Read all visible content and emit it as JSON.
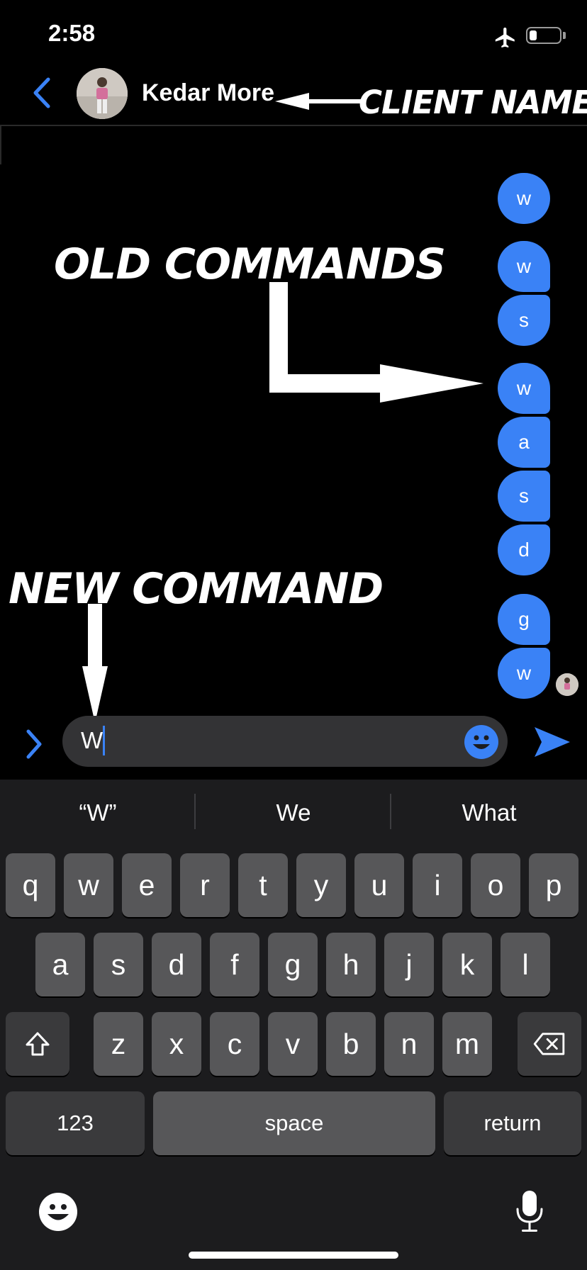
{
  "status_bar": {
    "time": "2:58",
    "airplane_icon": "airplane-icon",
    "battery_level": 0.25
  },
  "header": {
    "contact_name": "Kedar More",
    "back_icon": "chevron-left-icon"
  },
  "annotations": {
    "client_name": "CLIENT NAME",
    "old_commands": "OLD COMMANDS",
    "new_command": "NEW COMMAND"
  },
  "messages": [
    "w",
    "w",
    "s",
    "w",
    "a",
    "s",
    "d",
    "g",
    "w"
  ],
  "compose": {
    "text": "W"
  },
  "keyboard": {
    "suggestions": [
      "“W”",
      "We",
      "What"
    ],
    "row1": [
      "q",
      "w",
      "e",
      "r",
      "t",
      "y",
      "u",
      "i",
      "o",
      "p"
    ],
    "row2": [
      "a",
      "s",
      "d",
      "f",
      "g",
      "h",
      "j",
      "k",
      "l"
    ],
    "row3": [
      "z",
      "x",
      "c",
      "v",
      "b",
      "n",
      "m"
    ],
    "numbers_label": "123",
    "space_label": "space",
    "return_label": "return"
  },
  "colors": {
    "accent": "#3a82f6",
    "background": "#000000",
    "keyboard": "#1c1c1e",
    "key": "#575759"
  }
}
